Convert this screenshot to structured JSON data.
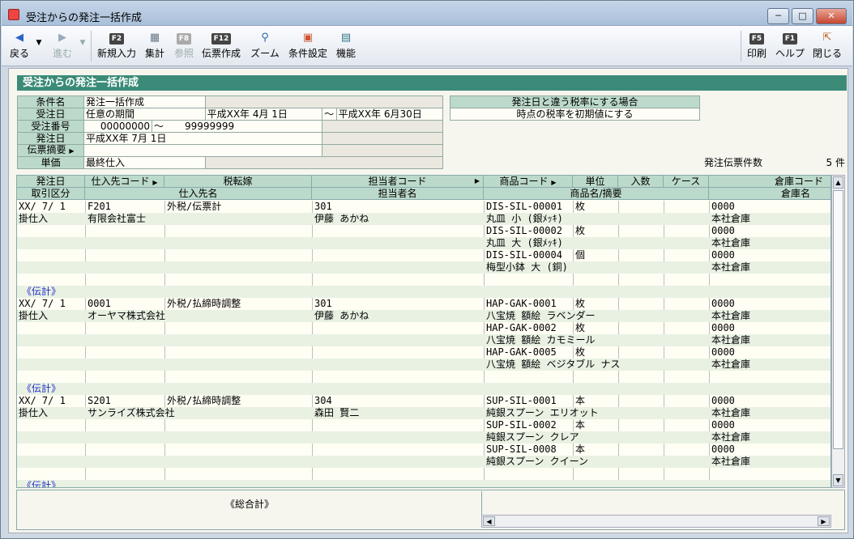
{
  "window": {
    "title": "受注からの発注一括作成",
    "min": "─",
    "max": "□",
    "close": "✕"
  },
  "toolbar": {
    "back": "戻る",
    "forward": "進む",
    "new": {
      "key": "F2",
      "label": "新規入力"
    },
    "calc": {
      "label": "集計"
    },
    "ref": {
      "key": "F8",
      "label": "参照"
    },
    "slip": {
      "key": "F12",
      "label": "伝票作成"
    },
    "zoom": {
      "label": "ズーム"
    },
    "cond": {
      "label": "条件設定"
    },
    "func": {
      "label": "機能"
    },
    "print": {
      "key": "F5",
      "label": "印刷"
    },
    "help": {
      "key": "F1",
      "label": "ヘルプ"
    },
    "closeapp": {
      "label": "閉じる"
    }
  },
  "page_title": "受注からの発注一括作成",
  "conditions": {
    "name_label": "条件名",
    "name_value": "発注一括作成",
    "order_date_label": "受注日",
    "order_date_mode": "任意の期間",
    "order_date_from": "平成XX年 4月 1日",
    "tilde": "～",
    "order_date_to": "平成XX年 6月30日",
    "order_no_label": "受注番号",
    "order_no_from": "00000000",
    "order_no_to": "99999999",
    "po_date_label": "発注日",
    "po_date_value": "平成XX年 7月 1日",
    "memo_label": "伝票摘要",
    "price_label": "単価",
    "price_value": "最終仕入"
  },
  "tax": {
    "title": "発注日と違う税率にする場合",
    "value": "時点の税率を初期値にする"
  },
  "count": {
    "label": "発注伝票件数",
    "value": "5 件"
  },
  "headers": {
    "r1": [
      "発注日",
      "仕入先コード",
      "税転嫁",
      "担当者コード",
      "商品コード",
      "単位",
      "入数",
      "ケース",
      "倉庫コード"
    ],
    "r2": [
      "取引区分",
      "仕入先名",
      "担当者名",
      "商品名/摘要",
      "倉庫名"
    ]
  },
  "rows": [
    {
      "date": "XX/ 7/ 1",
      "sup": "F201",
      "tax": "外税/伝票計",
      "staff": "301",
      "item": "DIS-SIL-00001",
      "unit": "枚",
      "wh": "0000"
    },
    {
      "date": "掛仕入",
      "sup": "有限会社富士",
      "staff": "伊藤 あかね",
      "item": "丸皿 小 (銀ﾒｯｷ)",
      "wh": "本社倉庫"
    },
    {
      "item": "DIS-SIL-00002",
      "unit": "枚",
      "wh": "0000"
    },
    {
      "item": "丸皿 大 (銀ﾒｯｷ)",
      "wh": "本社倉庫"
    },
    {
      "item": "DIS-SIL-00004",
      "unit": "個",
      "wh": "0000"
    },
    {
      "item": "梅型小鉢 大 (銅)",
      "wh": "本社倉庫"
    },
    {},
    {
      "total": "《伝計》"
    },
    {
      "date": "XX/ 7/ 1",
      "sup": "0001",
      "tax": "外税/払締時調整",
      "staff": "301",
      "item": "HAP-GAK-0001",
      "unit": "枚",
      "wh": "0000"
    },
    {
      "date": "掛仕入",
      "sup": "オーヤマ株式会社",
      "staff": "伊藤 あかね",
      "item": "八宝焼 額絵 ラベンダー",
      "wh": "本社倉庫"
    },
    {
      "item": "HAP-GAK-0002",
      "unit": "枚",
      "wh": "0000"
    },
    {
      "item": "八宝焼 額絵 カモミール",
      "wh": "本社倉庫"
    },
    {
      "item": "HAP-GAK-0005",
      "unit": "枚",
      "wh": "0000"
    },
    {
      "item": "八宝焼 額絵 ベジタブル ナス",
      "wh": "本社倉庫"
    },
    {},
    {
      "total": "《伝計》"
    },
    {
      "date": "XX/ 7/ 1",
      "sup": "S201",
      "tax": "外税/払締時調整",
      "staff": "304",
      "item": "SUP-SIL-0001",
      "unit": "本",
      "wh": "0000"
    },
    {
      "date": "掛仕入",
      "sup": "サンライズ株式会社",
      "staff": "森田 賢二",
      "item": "純銀スプーン エリオット",
      "wh": "本社倉庫"
    },
    {
      "item": "SUP-SIL-0002",
      "unit": "本",
      "wh": "0000"
    },
    {
      "item": "純銀スプーン クレア",
      "wh": "本社倉庫"
    },
    {
      "item": "SUP-SIL-0008",
      "unit": "本",
      "wh": "0000"
    },
    {
      "item": "純銀スプーン クイーン",
      "wh": "本社倉庫"
    },
    {},
    {
      "total": "《伝計》"
    }
  ],
  "grand_total": "《総合計》"
}
